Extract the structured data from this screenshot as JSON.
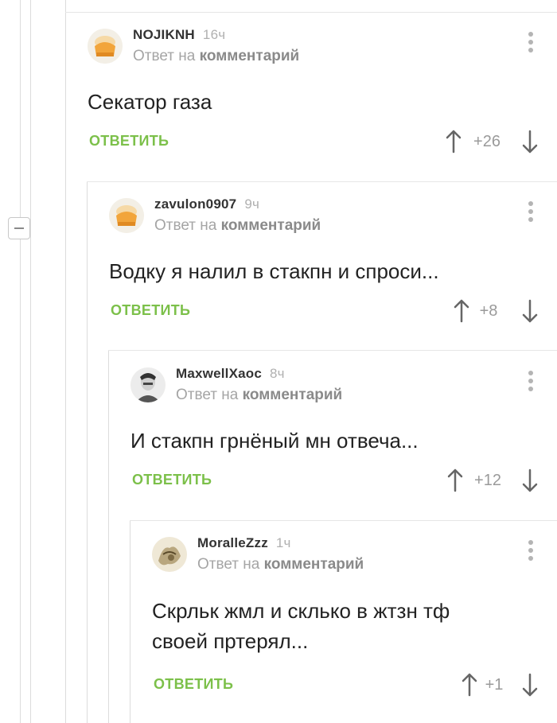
{
  "comments": [
    {
      "author": "NOJIKNH",
      "time": "16ч",
      "reply_prefix": "Ответ на",
      "reply_link": "комментарий",
      "text": "Секатор газа",
      "reply_label": "ОТВЕТИТЬ",
      "score": "+26",
      "avatar": "cap-icon"
    },
    {
      "author": "zavulon0907",
      "time": "9ч",
      "reply_prefix": "Ответ на",
      "reply_link": "комментарий",
      "text": "Водку я налил в стакпн и спроси...",
      "reply_label": "ОТВЕТИТЬ",
      "score": "+8",
      "avatar": "cap-icon"
    },
    {
      "author": "MaxwellXaoc",
      "time": "8ч",
      "reply_prefix": "Ответ на",
      "reply_link": "комментарий",
      "text": "И стакпн грнёный мн отвеча...",
      "reply_label": "ОТВЕТИТЬ",
      "score": "+12",
      "avatar": "portrait-photo"
    },
    {
      "author": "MoralleZzz",
      "time": "1ч",
      "reply_prefix": "Ответ на",
      "reply_link": "комментарий",
      "text_line1": "Скрльк жмл и склько в жтзн тф",
      "text_line2": "своей пртерял...",
      "reply_label": "ОТВЕТИТЬ",
      "score": "+1",
      "avatar": "sketch-photo"
    }
  ],
  "colors": {
    "accent_green": "#7cc04a",
    "muted_text": "#a5a5a5",
    "thread_line": "#dcdcdc"
  }
}
